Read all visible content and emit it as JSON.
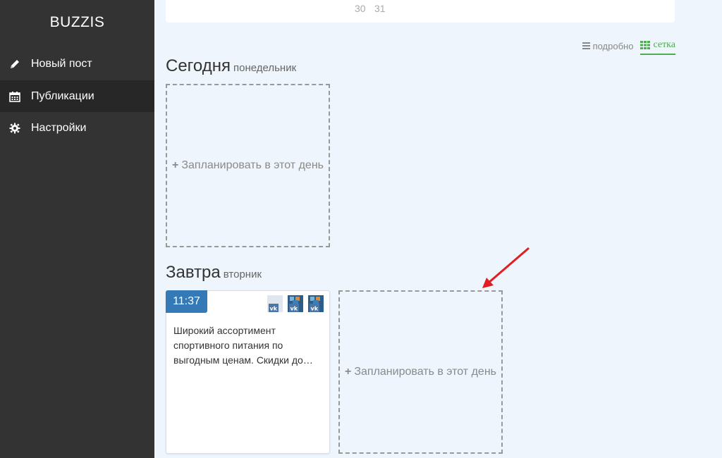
{
  "sidebar": {
    "brand": "BUZZIS",
    "items": [
      {
        "label": "Новый пост",
        "icon": "pencil-icon"
      },
      {
        "label": "Публикации",
        "icon": "calendar-icon",
        "active": true
      },
      {
        "label": "Настройки",
        "icon": "gear-icon"
      }
    ]
  },
  "calendar": {
    "dates": [
      "30",
      "31"
    ]
  },
  "view_toggle": {
    "list_label": "подробно",
    "grid_label": "сетка",
    "selected": "сетка"
  },
  "days": [
    {
      "title": "Сегодня",
      "weekday": "понедельник",
      "plan_label": "Запланировать в этот день"
    },
    {
      "title": "Завтра",
      "weekday": "вторник",
      "plan_label": "Запланировать в этот день",
      "post": {
        "time": "11:37",
        "text": "Широкий ассортимент спортивного питания по выгодным ценам. Скидки до…",
        "networks": [
          "vk-icon",
          "vk-icon",
          "vk-icon"
        ]
      }
    }
  ],
  "colors": {
    "sidebar_bg": "#333333",
    "active_item_bg": "#272727",
    "main_bg": "#eef5fd",
    "time_badge": "#337ab7",
    "grid_accent": "#4cae4c",
    "arrow": "#e02020"
  }
}
